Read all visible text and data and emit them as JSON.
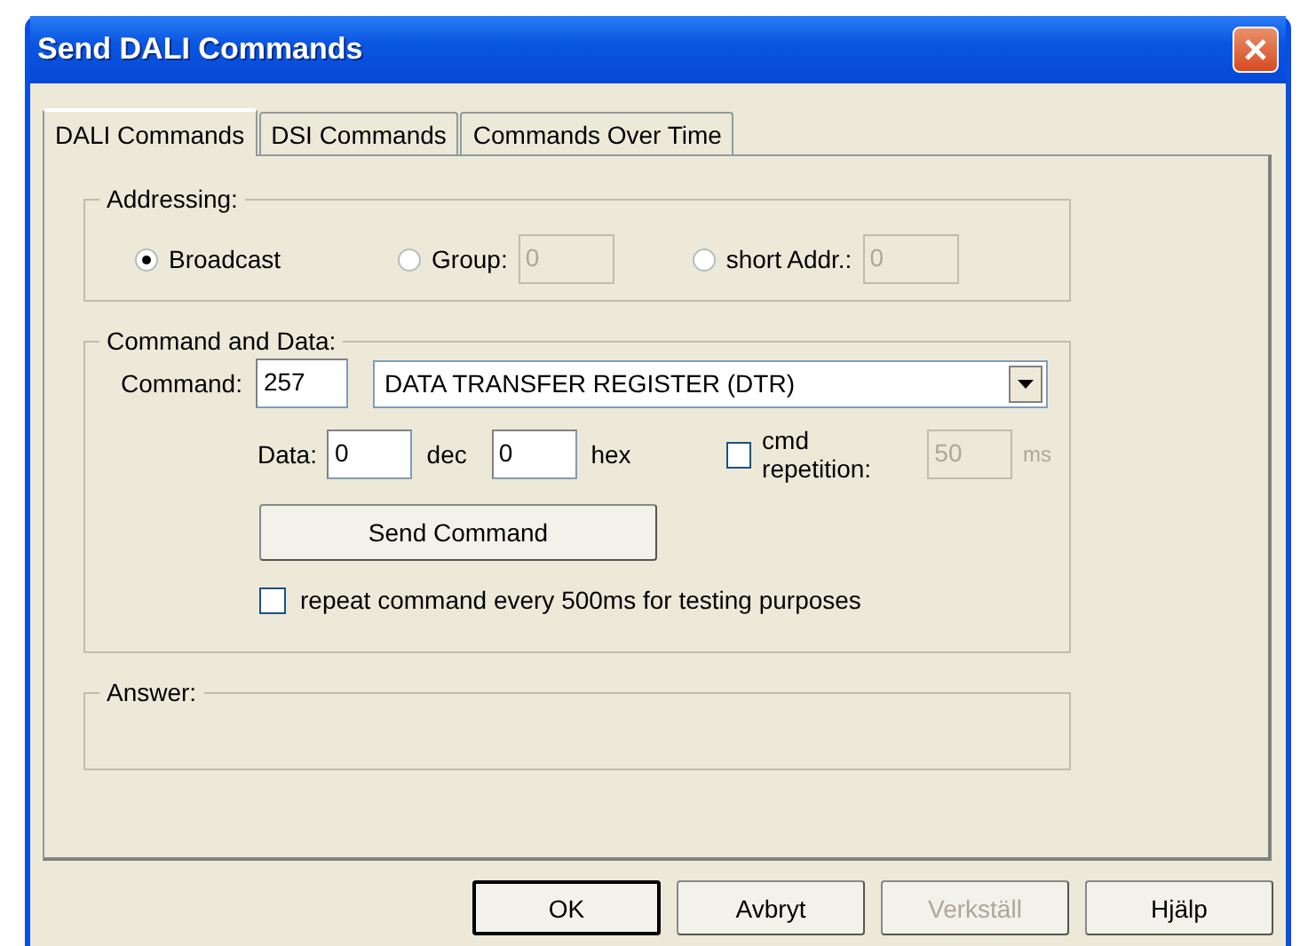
{
  "window": {
    "title": "Send DALI Commands"
  },
  "tabs": [
    {
      "label": "DALI Commands",
      "selected": true
    },
    {
      "label": "DSI Commands",
      "selected": false
    },
    {
      "label": "Commands Over Time",
      "selected": false
    }
  ],
  "addressing": {
    "title": "Addressing:",
    "options": [
      {
        "label": "Broadcast",
        "selected": true
      },
      {
        "label": "Group:",
        "selected": false,
        "field": {
          "value": "0",
          "disabled": true
        }
      },
      {
        "label": "short Addr.:",
        "selected": false,
        "field": {
          "value": "0",
          "disabled": true
        }
      }
    ]
  },
  "command_and_data": {
    "title": "Command and Data:",
    "command_label": "Command:",
    "command_value": "257",
    "command_select": "DATA TRANSFER REGISTER (DTR)",
    "data_label": "Data:",
    "dec_value": "0",
    "dec_label": "dec",
    "hex_value": "0",
    "hex_label": "hex",
    "cmd_repetition": {
      "label": "cmd repetition:",
      "checked": false,
      "value": "50",
      "unit": "ms",
      "disabled": true
    },
    "send_button": "Send Command",
    "repeat": {
      "label": "repeat command every 500ms for testing purposes",
      "checked": false
    }
  },
  "answer": {
    "title": "Answer:"
  },
  "buttons": [
    {
      "label": "OK",
      "default": true,
      "disabled": false
    },
    {
      "label": "Avbryt",
      "default": false,
      "disabled": false
    },
    {
      "label": "Verkställ",
      "default": false,
      "disabled": true
    },
    {
      "label": "Hjälp",
      "default": false,
      "disabled": false
    }
  ]
}
